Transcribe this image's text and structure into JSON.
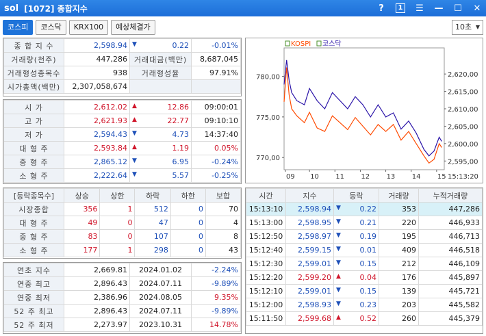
{
  "titlebar": {
    "logo": "sol",
    "title": "[1072] 종합지수",
    "help": "?",
    "count": "1",
    "menu": "☰",
    "min": "—",
    "max": "☐",
    "close": "✕"
  },
  "tabs": [
    "코스피",
    "코스닥",
    "KRX100",
    "예상체결가"
  ],
  "interval": "10초",
  "summary": {
    "row1": {
      "label": "종 합 지 수",
      "value": "2,598.94",
      "change": "0.22",
      "pct": "-0.01%"
    },
    "row2": {
      "label": "거래량(천주)",
      "value": "447,286",
      "label2": "거래대금(백만)",
      "value2": "8,687,045"
    },
    "row3": {
      "label": "거래형성종목수",
      "value": "938",
      "label2": "거래형성율",
      "value2": "97.91%"
    },
    "row4": {
      "label": "시가총액(백만)",
      "value": "2,307,058,674"
    }
  },
  "prices": [
    {
      "label": "시    가",
      "value": "2,612.02",
      "dir": "up",
      "change": "12.86",
      "extra": "09:00:01"
    },
    {
      "label": "고    가",
      "value": "2,621.93",
      "dir": "up",
      "change": "22.77",
      "extra": "09:10:10"
    },
    {
      "label": "저    가",
      "value": "2,594.43",
      "dir": "down",
      "change": "4.73",
      "extra": "14:37:40"
    },
    {
      "label": "대 형 주",
      "value": "2,593.84",
      "dir": "up",
      "change": "1.19",
      "extra": "0.05%"
    },
    {
      "label": "중 형 주",
      "value": "2,865.12",
      "dir": "down",
      "change": "6.95",
      "extra": "-0.24%"
    },
    {
      "label": "소 형 주",
      "value": "2,222.64",
      "dir": "down",
      "change": "5.57",
      "extra": "-0.25%"
    }
  ],
  "breadth": {
    "headers": [
      "[등락종목수]",
      "상승",
      "상한",
      "하락",
      "하한",
      "보합"
    ],
    "rows": [
      {
        "label": "시장종합",
        "rise": "356",
        "upper": "1",
        "fall": "512",
        "lower": "0",
        "flat": "70"
      },
      {
        "label": "대 형 주",
        "rise": "49",
        "upper": "0",
        "fall": "47",
        "lower": "0",
        "flat": "4"
      },
      {
        "label": "중 형 주",
        "rise": "83",
        "upper": "0",
        "fall": "107",
        "lower": "0",
        "flat": "8"
      },
      {
        "label": "소 형 주",
        "rise": "177",
        "upper": "1",
        "fall": "298",
        "lower": "0",
        "flat": "43"
      }
    ]
  },
  "yearly": [
    {
      "label": "연초  지수",
      "value": "2,669.81",
      "date": "2024.01.02",
      "pct": "-2.24%"
    },
    {
      "label": "연중  최고",
      "value": "2,896.43",
      "date": "2024.07.11",
      "pct": "-9.89%"
    },
    {
      "label": "연중  최저",
      "value": "2,386.96",
      "date": "2024.08.05",
      "pct": "9.35%"
    },
    {
      "label": "52 주 최고",
      "value": "2,896.43",
      "date": "2024.07.11",
      "pct": "-9.89%"
    },
    {
      "label": "52 주 최저",
      "value": "2,273.97",
      "date": "2023.10.31",
      "pct": "14.78%"
    }
  ],
  "ticks": {
    "headers": [
      "시간",
      "지수",
      "등락",
      "거래량",
      "누적거래량"
    ],
    "rows": [
      {
        "time": "15:13:10",
        "index": "2,598.94",
        "dir": "down",
        "change": "0.22",
        "vol": "353",
        "cum": "447,286"
      },
      {
        "time": "15:13:00",
        "index": "2,598.95",
        "dir": "down",
        "change": "0.21",
        "vol": "220",
        "cum": "446,933"
      },
      {
        "time": "15:12:50",
        "index": "2,598.97",
        "dir": "down",
        "change": "0.19",
        "vol": "195",
        "cum": "446,713"
      },
      {
        "time": "15:12:40",
        "index": "2,599.15",
        "dir": "down",
        "change": "0.01",
        "vol": "409",
        "cum": "446,518"
      },
      {
        "time": "15:12:30",
        "index": "2,599.01",
        "dir": "down",
        "change": "0.15",
        "vol": "212",
        "cum": "446,109"
      },
      {
        "time": "15:12:20",
        "index": "2,599.20",
        "dir": "up",
        "change": "0.04",
        "vol": "176",
        "cum": "445,897"
      },
      {
        "time": "15:12:10",
        "index": "2,599.01",
        "dir": "down",
        "change": "0.15",
        "vol": "139",
        "cum": "445,721"
      },
      {
        "time": "15:12:00",
        "index": "2,598.93",
        "dir": "down",
        "change": "0.23",
        "vol": "203",
        "cum": "445,582"
      },
      {
        "time": "15:11:50",
        "index": "2,599.68",
        "dir": "up",
        "change": "0.52",
        "vol": "260",
        "cum": "445,379"
      }
    ]
  },
  "colors": {
    "up": "#d0152a",
    "down": "#1d4fb8",
    "kospi": "#ff4a00",
    "kosdaq": "#2b14a8"
  },
  "chart_data": {
    "type": "line",
    "legend": [
      "KOSPI",
      "코스닥"
    ],
    "x_ticks": [
      "09",
      "10",
      "11",
      "12",
      "13",
      "14",
      "15"
    ],
    "time_label": "15:13:20",
    "left_axis": {
      "ticks": [
        "780,00",
        "775,00",
        "770,00"
      ],
      "range": [
        768.5,
        783.5
      ]
    },
    "right_axis": {
      "ticks": [
        "2,620,00",
        "2,615,00",
        "2,610,00",
        "2,605,00",
        "2,600,00",
        "2,595,00"
      ],
      "range": [
        2592.5,
        2627.5
      ]
    },
    "series": [
      {
        "name": "KOSPI",
        "axis": "right",
        "x": [
          9.0,
          9.1,
          9.2,
          9.3,
          9.5,
          9.8,
          10.0,
          10.3,
          10.6,
          10.9,
          11.2,
          11.5,
          11.8,
          12.1,
          12.4,
          12.7,
          13.0,
          13.3,
          13.6,
          13.9,
          14.2,
          14.5,
          14.7,
          14.9,
          15.1,
          15.2
        ],
        "y": [
          2612.0,
          2621.9,
          2614.0,
          2610.0,
          2608.0,
          2606.0,
          2609.0,
          2604.5,
          2603.5,
          2608.0,
          2606.0,
          2604.0,
          2607.5,
          2605.0,
          2602.5,
          2605.5,
          2603.5,
          2605.5,
          2601.0,
          2603.5,
          2600.0,
          2596.5,
          2594.4,
          2595.5,
          2600.0,
          2598.9
        ]
      },
      {
        "name": "코스닥",
        "axis": "left",
        "x": [
          9.0,
          9.1,
          9.2,
          9.3,
          9.5,
          9.8,
          10.0,
          10.3,
          10.6,
          10.9,
          11.2,
          11.5,
          11.8,
          12.1,
          12.4,
          12.7,
          13.0,
          13.3,
          13.6,
          13.9,
          14.2,
          14.5,
          14.7,
          14.9,
          15.1,
          15.2
        ],
        "y": [
          779.0,
          782.0,
          779.5,
          778.0,
          777.0,
          776.5,
          778.5,
          777.0,
          776.0,
          778.0,
          777.0,
          776.0,
          777.5,
          776.5,
          775.0,
          776.5,
          775.0,
          775.5,
          773.5,
          774.5,
          773.0,
          771.0,
          770.2,
          770.8,
          772.5,
          772.0
        ]
      }
    ]
  }
}
